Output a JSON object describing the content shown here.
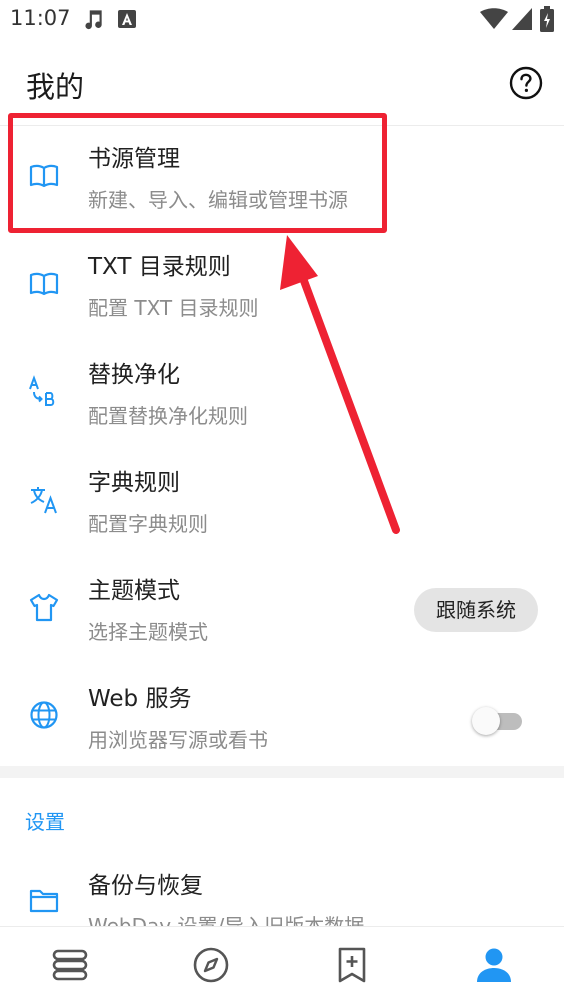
{
  "status_bar": {
    "time": "11:07"
  },
  "header": {
    "title": "我的"
  },
  "items": [
    {
      "title": "书源管理",
      "subtitle": "新建、导入、编辑或管理书源"
    },
    {
      "title": "TXT 目录规则",
      "subtitle": "配置 TXT 目录规则"
    },
    {
      "title": "替换净化",
      "subtitle": "配置替换净化规则"
    },
    {
      "title": "字典规则",
      "subtitle": "配置字典规则"
    },
    {
      "title": "主题模式",
      "subtitle": "选择主题模式",
      "value": "跟随系统"
    },
    {
      "title": "Web 服务",
      "subtitle": "用浏览器写源或看书",
      "enabled": false
    }
  ],
  "section": {
    "label": "设置"
  },
  "backup": {
    "title": "备份与恢复",
    "subtitle": "WebDav 设置/导入旧版本数据"
  },
  "colors": {
    "accent": "#2196f3",
    "annotation": "#ee2233"
  }
}
